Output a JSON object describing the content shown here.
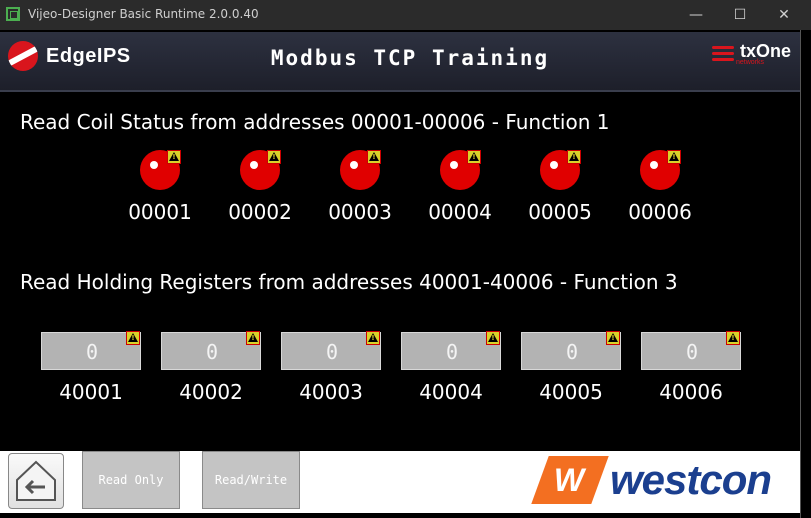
{
  "window": {
    "title": "Vijeo-Designer Basic Runtime 2.0.0.40",
    "minimize": "—",
    "maximize": "☐",
    "close": "✕"
  },
  "header": {
    "brand_left": "EdgeIPS",
    "title": "Modbus TCP Training",
    "brand_right": "txOne",
    "brand_right_sub": "networks"
  },
  "coils": {
    "heading": "Read Coil Status from addresses 00001-00006 - Function 1",
    "items": [
      {
        "address": "00001"
      },
      {
        "address": "00002"
      },
      {
        "address": "00003"
      },
      {
        "address": "00004"
      },
      {
        "address": "00005"
      },
      {
        "address": "00006"
      }
    ],
    "indicator_color": "#e00000"
  },
  "registers": {
    "heading": "Read Holding Registers from addresses 40001-40006 - Function 3",
    "items": [
      {
        "address": "40001",
        "value": "0"
      },
      {
        "address": "40002",
        "value": "0"
      },
      {
        "address": "40003",
        "value": "0"
      },
      {
        "address": "40004",
        "value": "0"
      },
      {
        "address": "40005",
        "value": "0"
      },
      {
        "address": "40006",
        "value": "0"
      }
    ]
  },
  "footer": {
    "read_only_label": "Read Only",
    "read_write_label": "Read/Write",
    "home_icon": "home-back-icon",
    "logo": "westcon"
  }
}
